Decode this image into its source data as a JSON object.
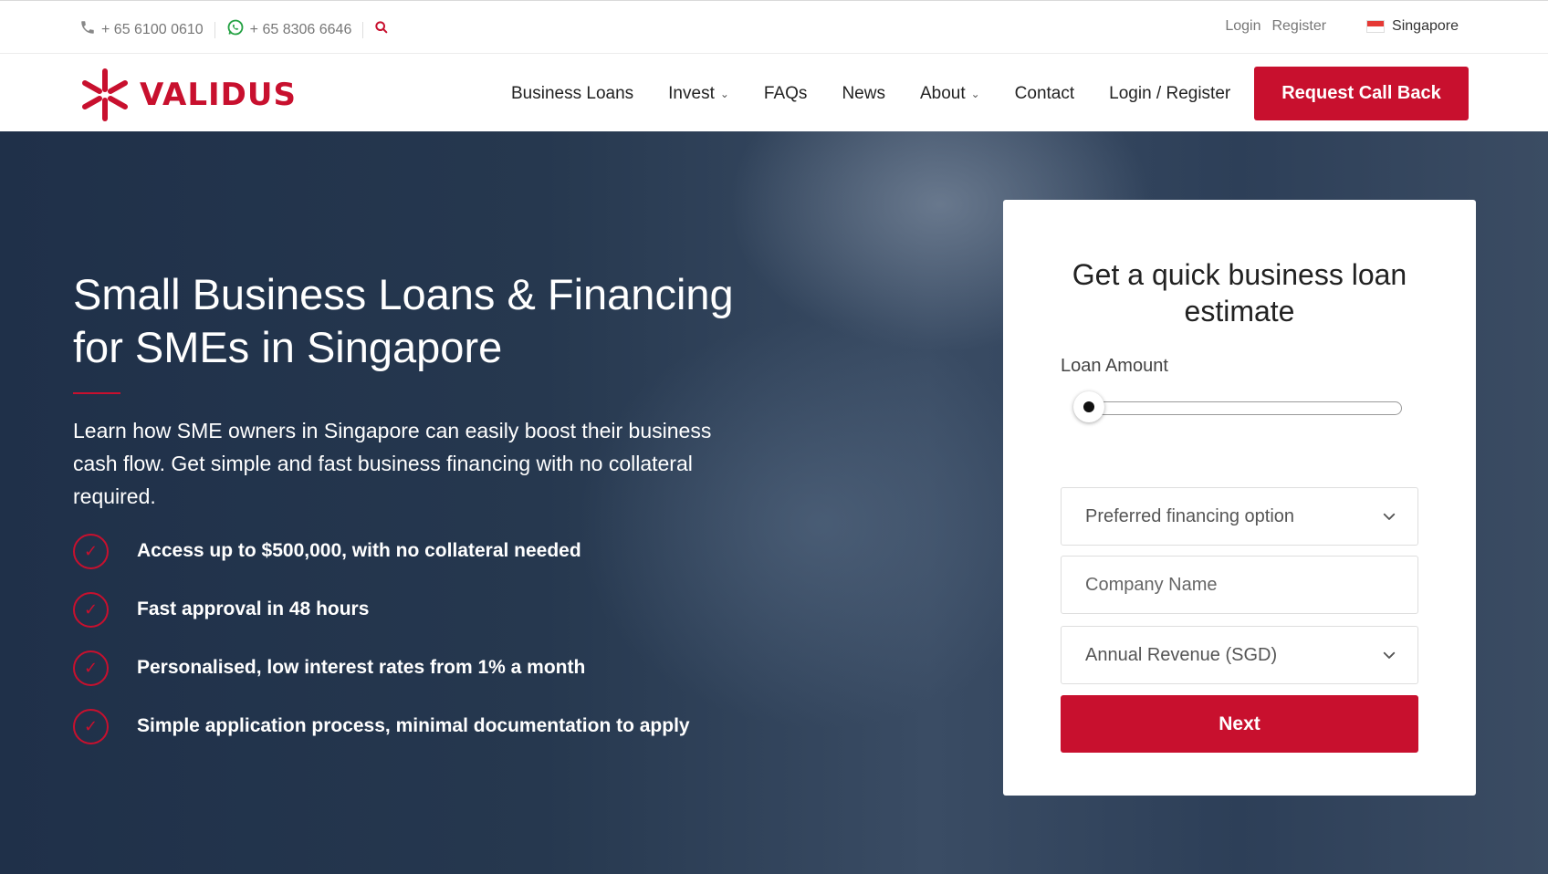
{
  "topbar": {
    "phone": "+ 65 6100 0610",
    "whatsapp": "+ 65 8306 6646",
    "login": "Login",
    "register": "Register",
    "country": "Singapore"
  },
  "brand": {
    "name": "VALIDUS",
    "color": "#c8102e"
  },
  "nav": {
    "items": [
      {
        "label": "Business Loans"
      },
      {
        "label": "Invest"
      },
      {
        "label": "FAQs"
      },
      {
        "label": "News"
      },
      {
        "label": "About"
      },
      {
        "label": "Contact"
      },
      {
        "label": "Login / Register"
      }
    ],
    "cta": "Request Call Back"
  },
  "hero": {
    "title": "Small Business Loans & Financing for SMEs in Singapore",
    "lead": "Learn how SME owners in Singapore can easily boost their business cash flow. Get simple and fast business financing with no collateral required.",
    "features": [
      "Access up to $500,000, with no collateral needed",
      "Fast approval in 48 hours",
      "Personalised, low interest rates from 1% a month",
      "Simple application process, minimal documentation to apply"
    ]
  },
  "form": {
    "title": "Get a quick business loan estimate",
    "loan_amount_label": "Loan Amount",
    "loan_amount_level": 0,
    "financing_option": "Preferred financing option",
    "company_name_placeholder": "Company Name",
    "annual_revenue": "Annual Revenue (SGD)",
    "next": "Next"
  },
  "icons": {
    "phone": "phone-icon",
    "whatsapp": "whatsapp-icon",
    "search": "search-icon",
    "flag": "singapore-flag-icon",
    "check": "check-circle-icon",
    "chevron": "chevron-down-icon"
  }
}
